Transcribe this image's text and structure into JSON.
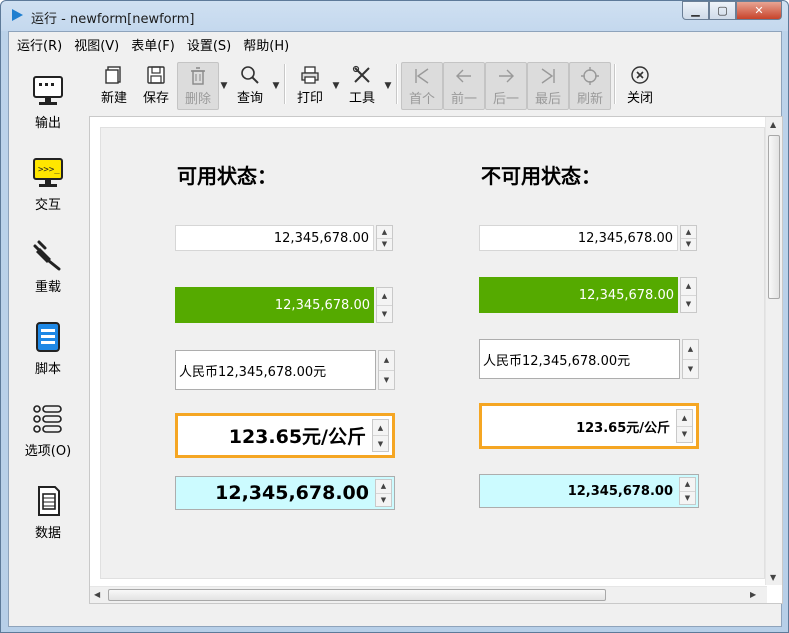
{
  "window": {
    "title": "运行 - newform[newform]"
  },
  "menu": [
    "运行(R)",
    "视图(V)",
    "表单(F)",
    "设置(S)",
    "帮助(H)"
  ],
  "sidebar": [
    {
      "label": "输出",
      "icon": "monitor-icon"
    },
    {
      "label": "交互",
      "icon": "terminal-icon"
    },
    {
      "label": "重载",
      "icon": "plug-icon"
    },
    {
      "label": "脚本",
      "icon": "script-icon"
    },
    {
      "label": "选项(O)",
      "icon": "options-list-icon"
    },
    {
      "label": "数据",
      "icon": "database-icon"
    }
  ],
  "toolbar": {
    "new": "新建",
    "save": "保存",
    "delete": "删除",
    "query": "查询",
    "print": "打印",
    "tools": "工具",
    "first": "首个",
    "prev": "前一",
    "next": "后一",
    "last": "最后",
    "refresh": "刷新",
    "close": "关闭"
  },
  "form": {
    "available_title": "可用状态：",
    "unavailable_title": "不可用状态：",
    "fields": {
      "number": "12,345,678.00",
      "currency": "人民币12,345,678.00元",
      "unit_price": "123.65元/公斤",
      "bold_number": "12,345,678.00"
    }
  },
  "colors": {
    "green": "#55aa00",
    "orange": "#f5a623",
    "cyan": "#ccfbff"
  }
}
